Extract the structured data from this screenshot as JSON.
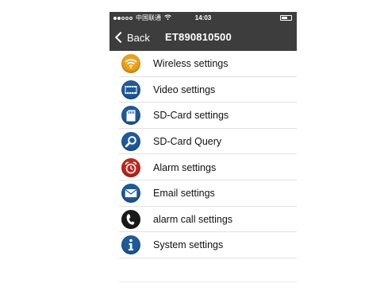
{
  "status_bar": {
    "carrier": "中国联通",
    "time": "14:03",
    "battery_level": 0.6
  },
  "nav": {
    "back_label": "Back",
    "title": "ET890810500"
  },
  "menu": {
    "items": [
      {
        "label": "Wireless settings",
        "icon": "wifi-icon",
        "color": "#e8a21c"
      },
      {
        "label": "Video settings",
        "icon": "film-icon",
        "color": "#1f5a99"
      },
      {
        "label": "SD-Card settings",
        "icon": "sd-card-icon",
        "color": "#1f5a99"
      },
      {
        "label": "SD-Card Query",
        "icon": "magnifier-icon",
        "color": "#1f5a99"
      },
      {
        "label": "Alarm settings",
        "icon": "alarm-clock-icon",
        "color": "#c0281e"
      },
      {
        "label": "Email settings",
        "icon": "envelope-icon",
        "color": "#1f5a99"
      },
      {
        "label": "alarm call settings",
        "icon": "phone-icon",
        "color": "#1a1a1a"
      },
      {
        "label": "System settings",
        "icon": "info-icon",
        "color": "#1f5a99"
      }
    ]
  }
}
